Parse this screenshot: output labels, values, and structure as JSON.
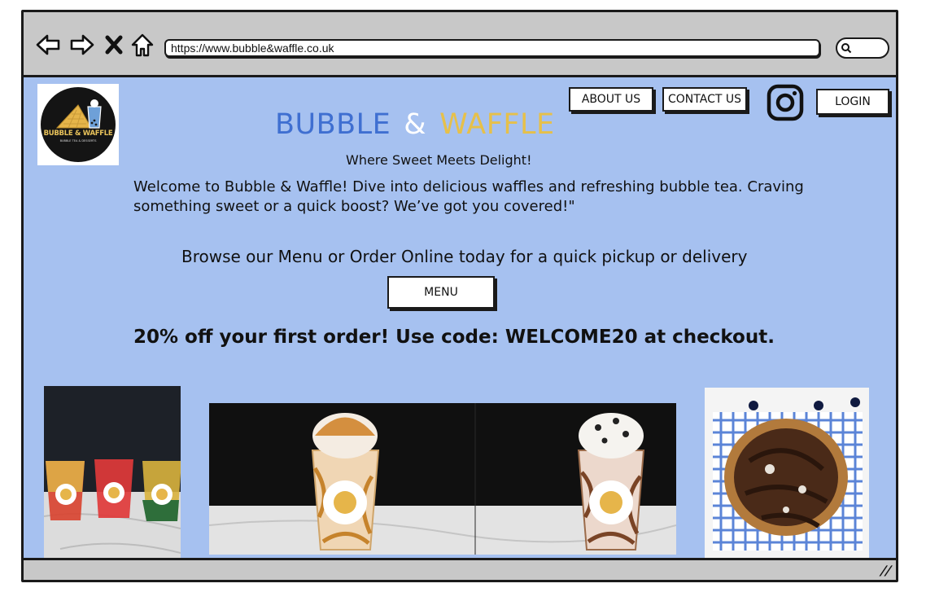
{
  "browser": {
    "url": "https://www.bubble&waffle.co.uk",
    "nav_icons": [
      "back-arrow-icon",
      "forward-arrow-icon",
      "close-x-icon",
      "home-icon",
      "search-icon"
    ]
  },
  "header": {
    "logo_text": "BUBBLE & WAFFLE",
    "logo_subtext": "BUBBLE TEA & DESSERTS",
    "nav": {
      "about_label": "ABOUT US",
      "contact_label": "CONTACT US",
      "login_label": "LOGIN"
    },
    "social_icon": "instagram-icon"
  },
  "hero": {
    "brand_part1": "BUBBLE",
    "brand_amp": "&",
    "brand_part2": "WAFFLE",
    "tagline": "Where Sweet Meets Delight!",
    "welcome_text": "Welcome to Bubble & Waffle! Dive into delicious waffles and refreshing bubble tea. Craving something sweet or a quick boost? We’ve got you covered!\"",
    "browse_text": "Browse our Menu or Order Online today for a quick pickup or delivery",
    "menu_button": "MENU",
    "promo_text": "20% off your first order! Use code: WELCOME20 at checkout."
  },
  "gallery": {
    "images": [
      "bubble-tea-drinks",
      "milkshakes",
      "waffle"
    ]
  },
  "colors": {
    "page_bg": "#a6c1f0",
    "brand_blue": "#3f6fd1",
    "brand_yellow": "#e6c04a",
    "chrome_grey": "#c8c8c8"
  }
}
